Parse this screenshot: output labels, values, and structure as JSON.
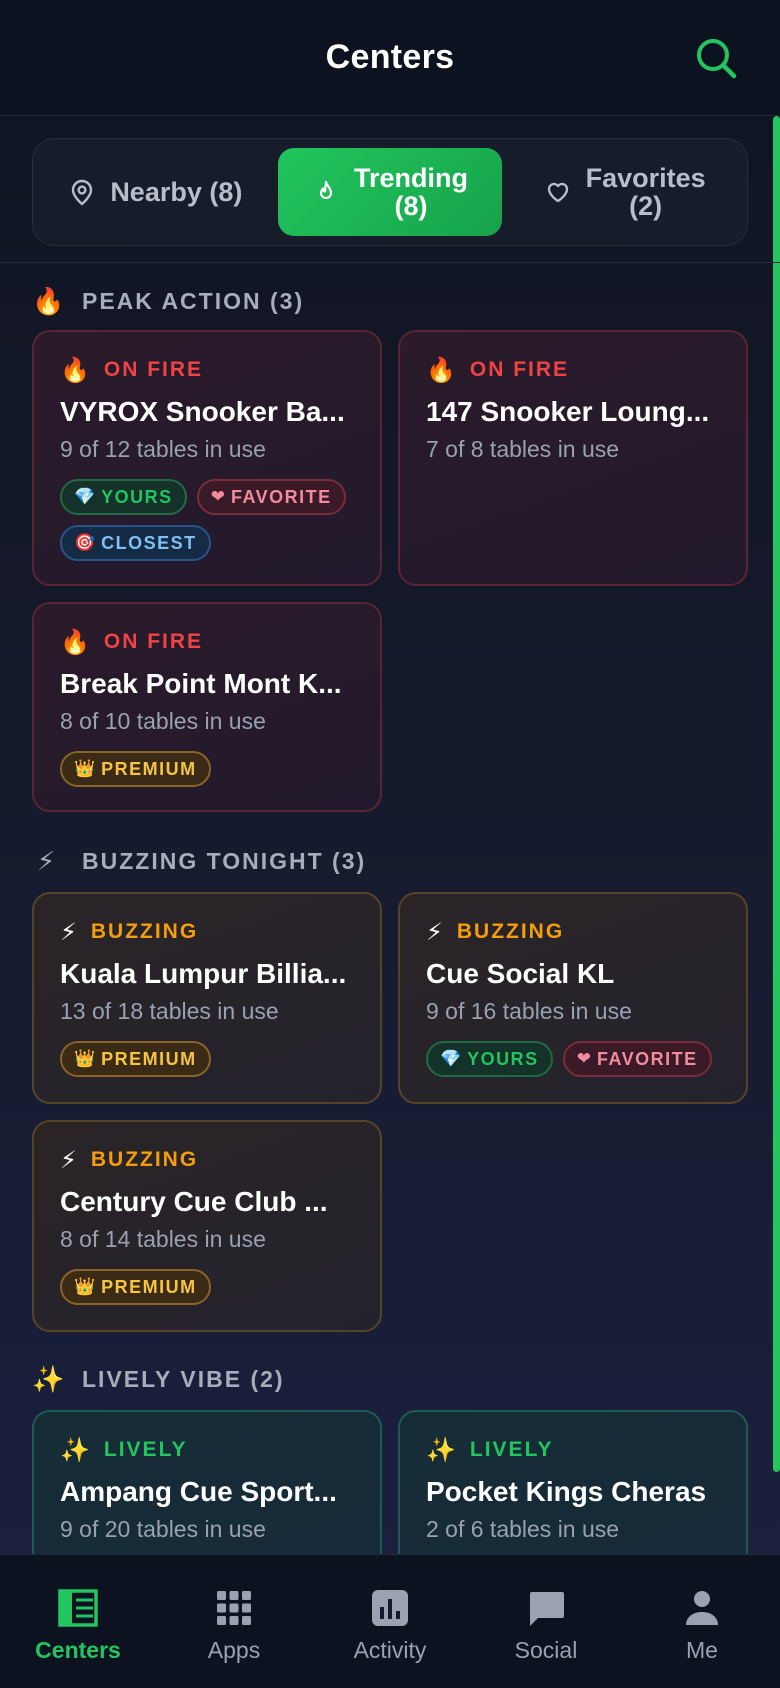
{
  "header": {
    "title": "Centers",
    "search_icon": "search-icon"
  },
  "tabs": [
    {
      "label": "Nearby (8)",
      "icon": "map-pin-icon",
      "active": false
    },
    {
      "label": "Trending\n(8)",
      "icon": "flame-icon",
      "active": true
    },
    {
      "label": "Favorites\n(2)",
      "icon": "heart-icon",
      "active": false
    }
  ],
  "sections": [
    {
      "emoji": "🔥",
      "title": "PEAK ACTION (3)",
      "cards": [
        {
          "status_emoji": "🔥",
          "status": "ON FIRE",
          "name": "VYROX Snooker Ba...",
          "usage": "9 of 12 tables in use",
          "badges": [
            {
              "emoji": "💎",
              "label": "YOURS"
            },
            {
              "emoji": "❤",
              "label": "FAVORITE"
            },
            {
              "emoji": "🎯",
              "label": "CLOSEST"
            }
          ]
        },
        {
          "status_emoji": "🔥",
          "status": "ON FIRE",
          "name": "147 Snooker Loung...",
          "usage": "7 of 8 tables in use",
          "badges": []
        },
        {
          "status_emoji": "🔥",
          "status": "ON FIRE",
          "name": "Break Point Mont K...",
          "usage": "8 of 10 tables in use",
          "badges": [
            {
              "emoji": "👑",
              "label": "PREMIUM"
            }
          ]
        }
      ]
    },
    {
      "emoji": "⚡",
      "title": "BUZZING TONIGHT (3)",
      "cards": [
        {
          "status_emoji": "⚡",
          "status": "BUZZING",
          "name": "Kuala Lumpur Billia...",
          "usage": "13 of 18 tables in use",
          "badges": [
            {
              "emoji": "👑",
              "label": "PREMIUM"
            }
          ]
        },
        {
          "status_emoji": "⚡",
          "status": "BUZZING",
          "name": "Cue Social KL",
          "usage": "9 of 16 tables in use",
          "badges": [
            {
              "emoji": "💎",
              "label": "YOURS"
            },
            {
              "emoji": "❤",
              "label": "FAVORITE"
            }
          ]
        },
        {
          "status_emoji": "⚡",
          "status": "BUZZING",
          "name": "Century Cue Club ...",
          "usage": "8 of 14 tables in use",
          "badges": [
            {
              "emoji": "👑",
              "label": "PREMIUM"
            }
          ]
        }
      ]
    },
    {
      "emoji": "✨",
      "title": "LIVELY VIBE (2)",
      "cards": [
        {
          "status_emoji": "✨",
          "status": "LIVELY",
          "name": "Ampang Cue Sport...",
          "usage": "9 of 20 tables in use",
          "badges": []
        },
        {
          "status_emoji": "✨",
          "status": "LIVELY",
          "name": "Pocket Kings Cheras",
          "usage": "2 of 6 tables in use",
          "badges": []
        }
      ]
    }
  ],
  "bottom_nav": [
    {
      "label": "Centers",
      "icon": "centers-icon",
      "active": true
    },
    {
      "label": "Apps",
      "icon": "apps-grid-icon",
      "active": false
    },
    {
      "label": "Activity",
      "icon": "activity-chart-icon",
      "active": false
    },
    {
      "label": "Social",
      "icon": "chat-bubble-icon",
      "active": false
    },
    {
      "label": "Me",
      "icon": "person-icon",
      "active": false
    }
  ],
  "colors": {
    "accent": "#22c55e",
    "fire": "#ef4444",
    "buzz": "#f59e0b",
    "background": "#0f1422"
  }
}
